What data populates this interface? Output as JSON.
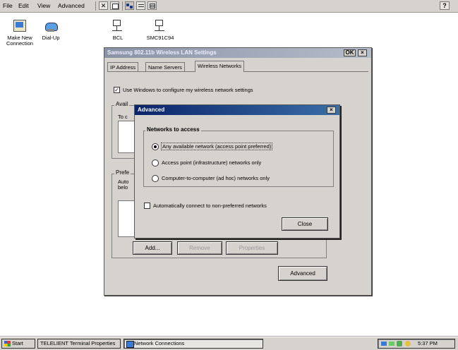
{
  "menubar": {
    "items": [
      "File",
      "Edit",
      "View",
      "Advanced"
    ],
    "help_button": "?"
  },
  "desktop_icons": [
    {
      "label": "Make New Connection",
      "icon": "new-connection-icon"
    },
    {
      "label": "Dial-Up",
      "icon": "dialup-icon"
    },
    {
      "label": "BCL",
      "icon": "network-adapter-icon"
    },
    {
      "label": "SMC91C94",
      "icon": "network-adapter-icon"
    }
  ],
  "settings_window": {
    "title": "Samsung 802.11b Wireless LAN Settings",
    "ok_label": "OK",
    "close_label": "×",
    "tabs": [
      "IP Address",
      "Name Servers",
      "Wireless Networks"
    ],
    "active_tab": "Wireless Networks",
    "use_windows_label": "Use Windows to configure my wireless network settings",
    "use_windows_checked": true,
    "available_group_label": "Avail",
    "available_hint": "To c",
    "preferred_group_label": "Prefe",
    "preferred_hint_1": "Auto",
    "preferred_hint_2": "belo",
    "add_label": "Add...",
    "remove_label": "Remove",
    "properties_label": "Properties",
    "advanced_label": "Advanced"
  },
  "advanced_dialog": {
    "title": "Advanced",
    "close_label": "×",
    "group_label": "Networks to access",
    "options": [
      {
        "label": "Any available network (access point preferred)",
        "selected": true
      },
      {
        "label": "Access point (infrastructure) networks only",
        "selected": false
      },
      {
        "label": "Computer-to-computer (ad hoc) networks only",
        "selected": false
      }
    ],
    "auto_connect_label": "Automatically connect to non-preferred networks",
    "auto_connect_checked": false,
    "close_button_label": "Close"
  },
  "taskbar": {
    "start_label": "Start",
    "tasks": [
      "TELELIENT Terminal Properties",
      "Network Connections"
    ],
    "clock": "5:37 PM"
  },
  "colors": {
    "titlebar_active": "#0a246a",
    "titlebar_active_end": "#3a6ea5",
    "titlebar_inactive": "#8a93a6",
    "face": "#d6d3ce"
  }
}
